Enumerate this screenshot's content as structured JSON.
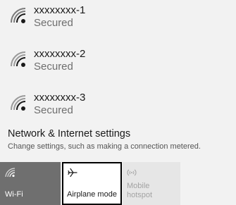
{
  "networks": [
    {
      "name": "xxxxxxxx-1",
      "status": "Secured",
      "icon": "wifi-secured-icon"
    },
    {
      "name": "xxxxxxxx-2",
      "status": "Secured",
      "icon": "wifi-secured-icon"
    },
    {
      "name": "xxxxxxxx-3",
      "status": "Secured",
      "icon": "wifi-secured-icon"
    }
  ],
  "settings": {
    "title": "Network & Internet settings",
    "description": "Change settings, such as making a connection metered."
  },
  "tiles": {
    "wifi": {
      "label": "Wi-Fi",
      "icon": "wifi-icon",
      "state": "on"
    },
    "airplane": {
      "label": "Airplane mode",
      "icon": "airplane-icon",
      "state": "focused"
    },
    "hotspot": {
      "label_line1": "Mobile",
      "label_line2": "hotspot",
      "icon": "hotspot-icon",
      "state": "disabled"
    }
  },
  "colors": {
    "background": "#f2f2f2",
    "wifi_tile": "#6f6f6f",
    "hotspot_tile": "#e6e6e6",
    "disabled_text": "#a3a3a3"
  }
}
